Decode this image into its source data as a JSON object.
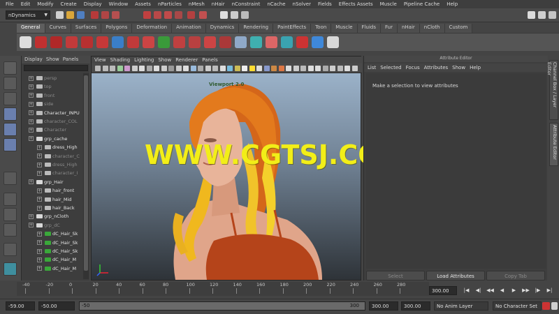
{
  "menubar": [
    "File",
    "Edit",
    "Modify",
    "Create",
    "Display",
    "Window",
    "Assets",
    "nParticles",
    "nMesh",
    "nHair",
    "nConstraint",
    "nCache",
    "nSolver",
    "Fields",
    "Effects Assets",
    "Muscle",
    "Pipeline Cache",
    "Help"
  ],
  "status": {
    "mode": "nDynamics"
  },
  "shelf": {
    "tabs": [
      "General",
      "Curves",
      "Surfaces",
      "Polygons",
      "Deformation",
      "Animation",
      "Dynamics",
      "Rendering",
      "PaintEffects",
      "Toon",
      "Muscle",
      "Fluids",
      "Fur",
      "nHair",
      "nCloth",
      "Custom"
    ],
    "active": "General"
  },
  "outliner": {
    "menu": [
      "Display",
      "Show",
      "Panels"
    ],
    "items": [
      {
        "label": "persp",
        "dim": true,
        "indent": 0,
        "exp": false
      },
      {
        "label": "top",
        "dim": true,
        "indent": 0,
        "exp": false
      },
      {
        "label": "front",
        "dim": true,
        "indent": 0,
        "exp": false
      },
      {
        "label": "side",
        "dim": true,
        "indent": 0,
        "exp": false
      },
      {
        "label": "Character_INPU",
        "dim": false,
        "indent": 0,
        "exp": true
      },
      {
        "label": "character_COL",
        "dim": true,
        "indent": 0,
        "exp": true
      },
      {
        "label": "Character",
        "dim": true,
        "indent": 0,
        "exp": false
      },
      {
        "label": "grp_cache",
        "dim": false,
        "indent": 0,
        "exp": true
      },
      {
        "label": "dress_High",
        "dim": false,
        "indent": 1,
        "exp": true
      },
      {
        "label": "character_C",
        "dim": true,
        "indent": 1,
        "exp": true
      },
      {
        "label": "dress_High",
        "dim": true,
        "indent": 1,
        "exp": true
      },
      {
        "label": "character_I",
        "dim": true,
        "indent": 1,
        "exp": true
      },
      {
        "label": "grp_Hair",
        "dim": false,
        "indent": 0,
        "exp": true
      },
      {
        "label": "hair_front",
        "dim": false,
        "indent": 1,
        "exp": true
      },
      {
        "label": "hair_Mid",
        "dim": false,
        "indent": 1,
        "exp": true
      },
      {
        "label": "hair_Back",
        "dim": false,
        "indent": 1,
        "exp": true
      },
      {
        "label": "grp_nCloth",
        "dim": false,
        "indent": 0,
        "exp": true
      },
      {
        "label": "grp_dC",
        "dim": true,
        "indent": 0,
        "exp": true
      },
      {
        "label": "dC_Hair_Sk",
        "dim": false,
        "indent": 1,
        "exp": true
      },
      {
        "label": "dC_Hair_Sk",
        "dim": false,
        "indent": 1,
        "exp": true
      },
      {
        "label": "dC_Hair_Sk",
        "dim": false,
        "indent": 1,
        "exp": true
      },
      {
        "label": "dC_Hair_M",
        "dim": false,
        "indent": 1,
        "exp": true
      },
      {
        "label": "dC_Hair_M",
        "dim": false,
        "indent": 1,
        "exp": true
      }
    ]
  },
  "viewport": {
    "menu": [
      "View",
      "Shading",
      "Lighting",
      "Show",
      "Renderer",
      "Panels"
    ],
    "label": "Viewport 2.0",
    "watermark": "WWW.CGTSJ.COM"
  },
  "attribute_editor": {
    "title": "Attribute Editor",
    "menu": [
      "List",
      "Selected",
      "Focus",
      "Attributes",
      "Show",
      "Help"
    ],
    "message": "Make a selection to view attributes",
    "buttons": {
      "select": "Select",
      "load": "Load Attributes",
      "copy": "Copy Tab"
    }
  },
  "side_tabs": {
    "channel": "Channel Box / Layer Editor",
    "attr": "Attribute Editor"
  },
  "timeline": {
    "ticks": [
      "-40",
      "-20",
      "0",
      "20",
      "40",
      "60",
      "80",
      "100",
      "120",
      "140",
      "160",
      "180",
      "200",
      "220",
      "240",
      "260",
      "280"
    ],
    "current_frame": "300.00"
  },
  "playback": [
    "|◀",
    "◀|",
    "◀◀",
    "◀",
    "▶",
    "▶▶",
    "|▶",
    "▶|"
  ],
  "range": {
    "anim_start": "-59.00",
    "start": "-50.00",
    "slider_start": "-50",
    "slider_end": "300",
    "end": "300.00",
    "anim_end": "300.00",
    "anim_layer": "No Anim Layer",
    "char_set": "No Character Set"
  },
  "colors": {
    "watermark": "#f2ee18",
    "viewport_label": "#2f5a2f"
  }
}
